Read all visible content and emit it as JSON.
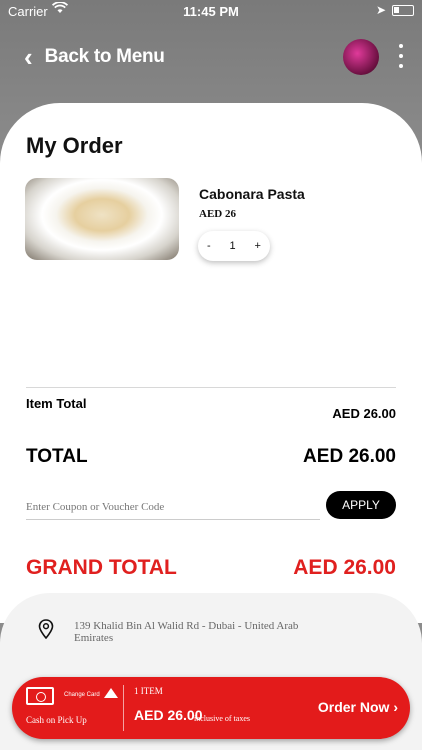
{
  "status_bar": {
    "carrier": "Carrier",
    "time": "11:45 PM"
  },
  "header": {
    "back_label": "Back to Menu",
    "back_icon": "chevron-left-icon",
    "menu_icon": "kebab-menu-icon"
  },
  "order": {
    "title": "My Order",
    "item": {
      "name": "Cabonara Pasta",
      "price": "AED 26",
      "quantity": "1",
      "decrement": "-",
      "increment": "+"
    },
    "item_total_label": "Item Total",
    "item_total_value": "AED 26.00",
    "total_label": "TOTAL",
    "total_value": "AED 26.00",
    "coupon_placeholder": "Enter Coupon or Voucher Code",
    "apply_label": "APPLY",
    "grand_total_label": "GRAND TOTAL",
    "grand_total_value": "AED 26.00"
  },
  "address": {
    "text": "139 Khalid Bin Al Walid Rd - Dubai - United Arab Emirates",
    "icon": "location-pin-icon"
  },
  "checkout_bar": {
    "change_card": "Change Card",
    "payment_method": "Cash on Pick Up",
    "items_count": "1 ITEM",
    "total": "AED 26.00",
    "tax_note": "inclusive of taxes",
    "order_now": "Order Now ›"
  },
  "colors": {
    "accent_red": "#e31b1b",
    "header_gray": "#8c8c8c"
  }
}
